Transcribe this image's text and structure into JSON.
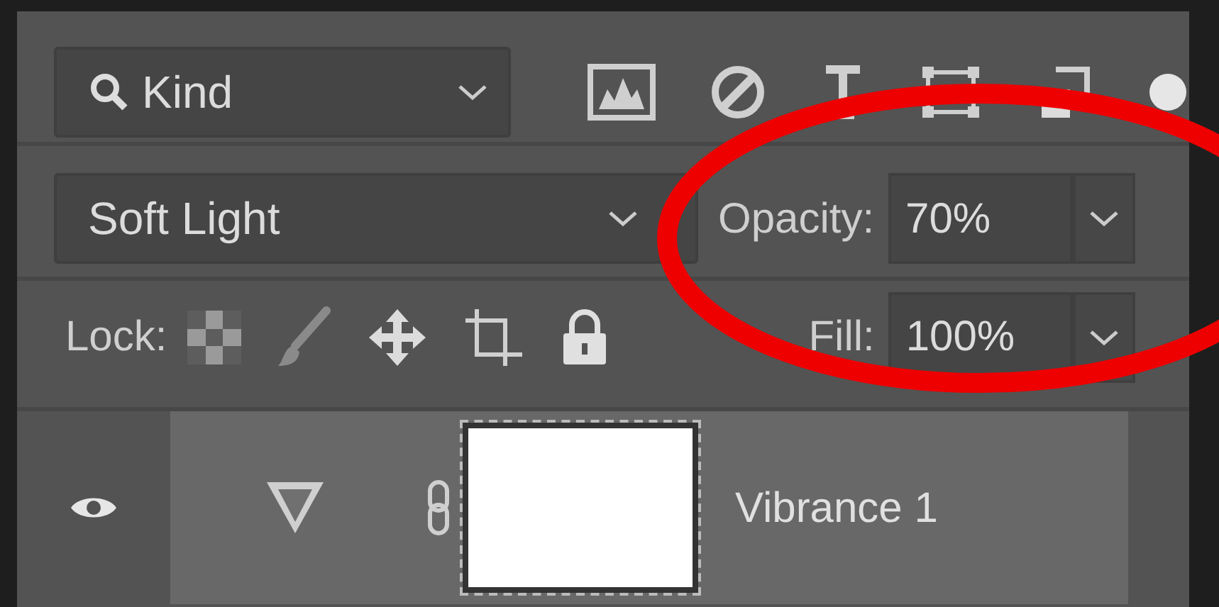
{
  "filter": {
    "value": "Kind"
  },
  "blend": {
    "mode": "Soft Light",
    "opacity_label": "Opacity:",
    "opacity": "70%"
  },
  "lock": {
    "label": "Lock:",
    "fill_label": "Fill:",
    "fill": "100%"
  },
  "layers": [
    {
      "name": "Vibrance 1",
      "visible": true,
      "selected": true
    }
  ]
}
